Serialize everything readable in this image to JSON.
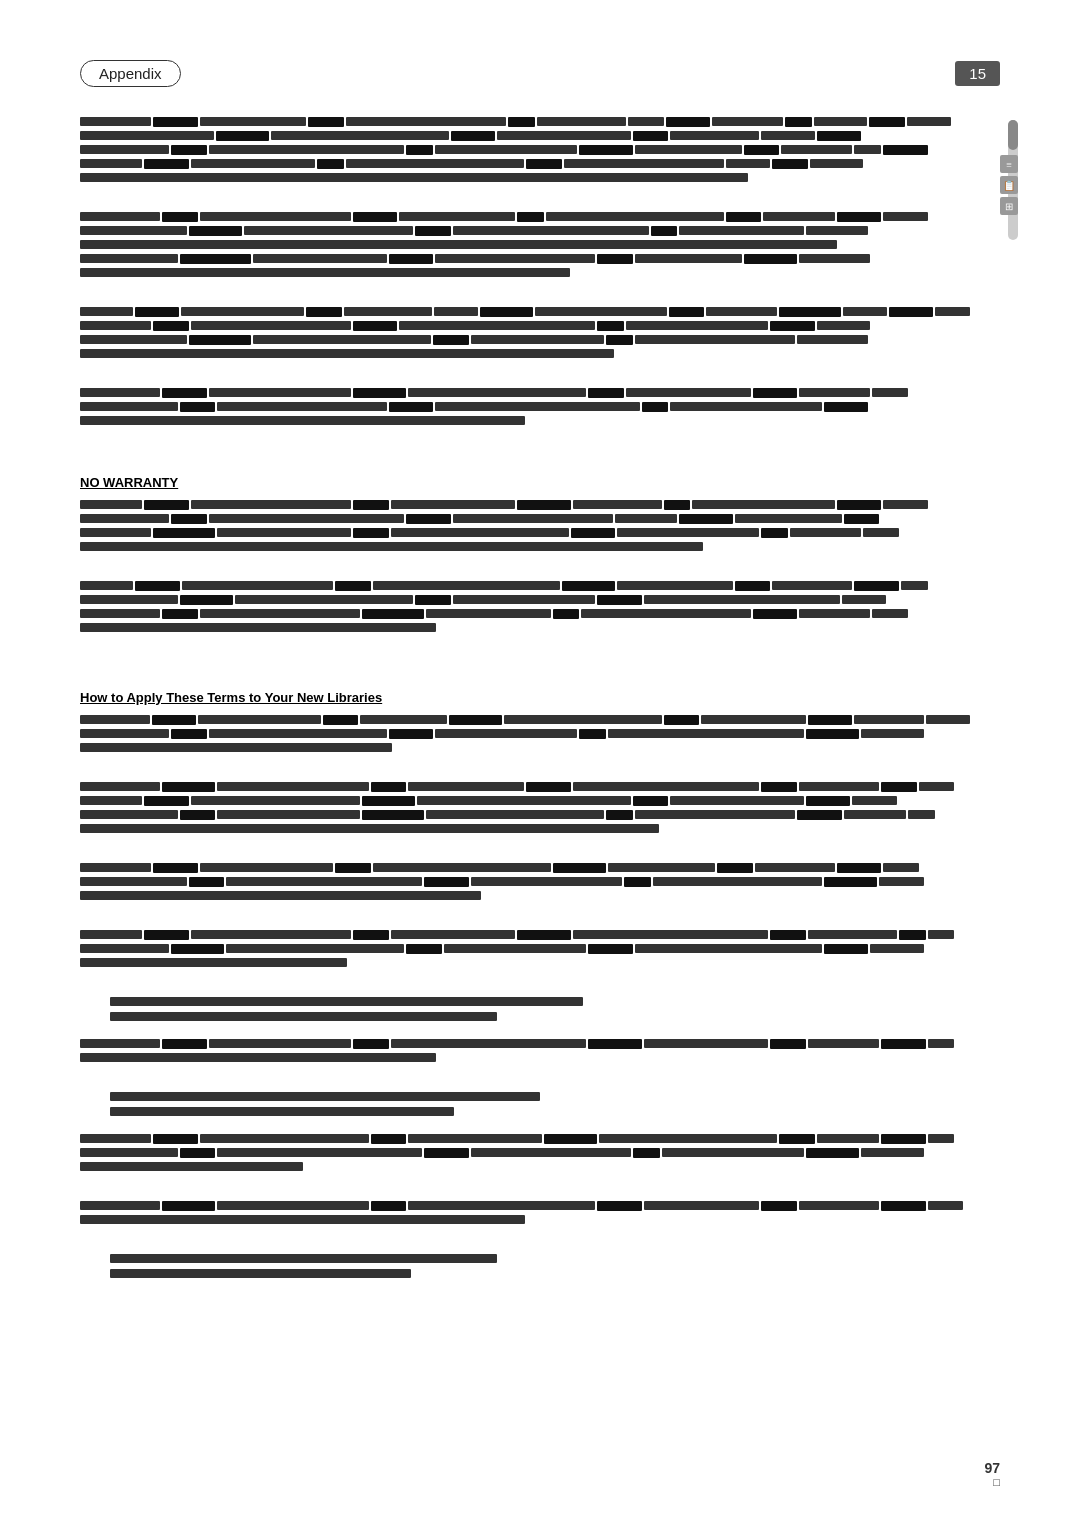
{
  "header": {
    "appendix_label": "Appendix",
    "page_number": "15"
  },
  "sections": {
    "no_warranty": {
      "heading": "NO WARRANTY"
    },
    "how_to_apply": {
      "heading": "How to Apply These Terms to Your New Libraries"
    }
  },
  "footer": {
    "page_number": "97",
    "sub_number": "□"
  },
  "scrollbar": {
    "label": "scrollbar"
  },
  "icons": {
    "icon1": "≡",
    "icon2": "📋",
    "icon3": "⊞"
  }
}
